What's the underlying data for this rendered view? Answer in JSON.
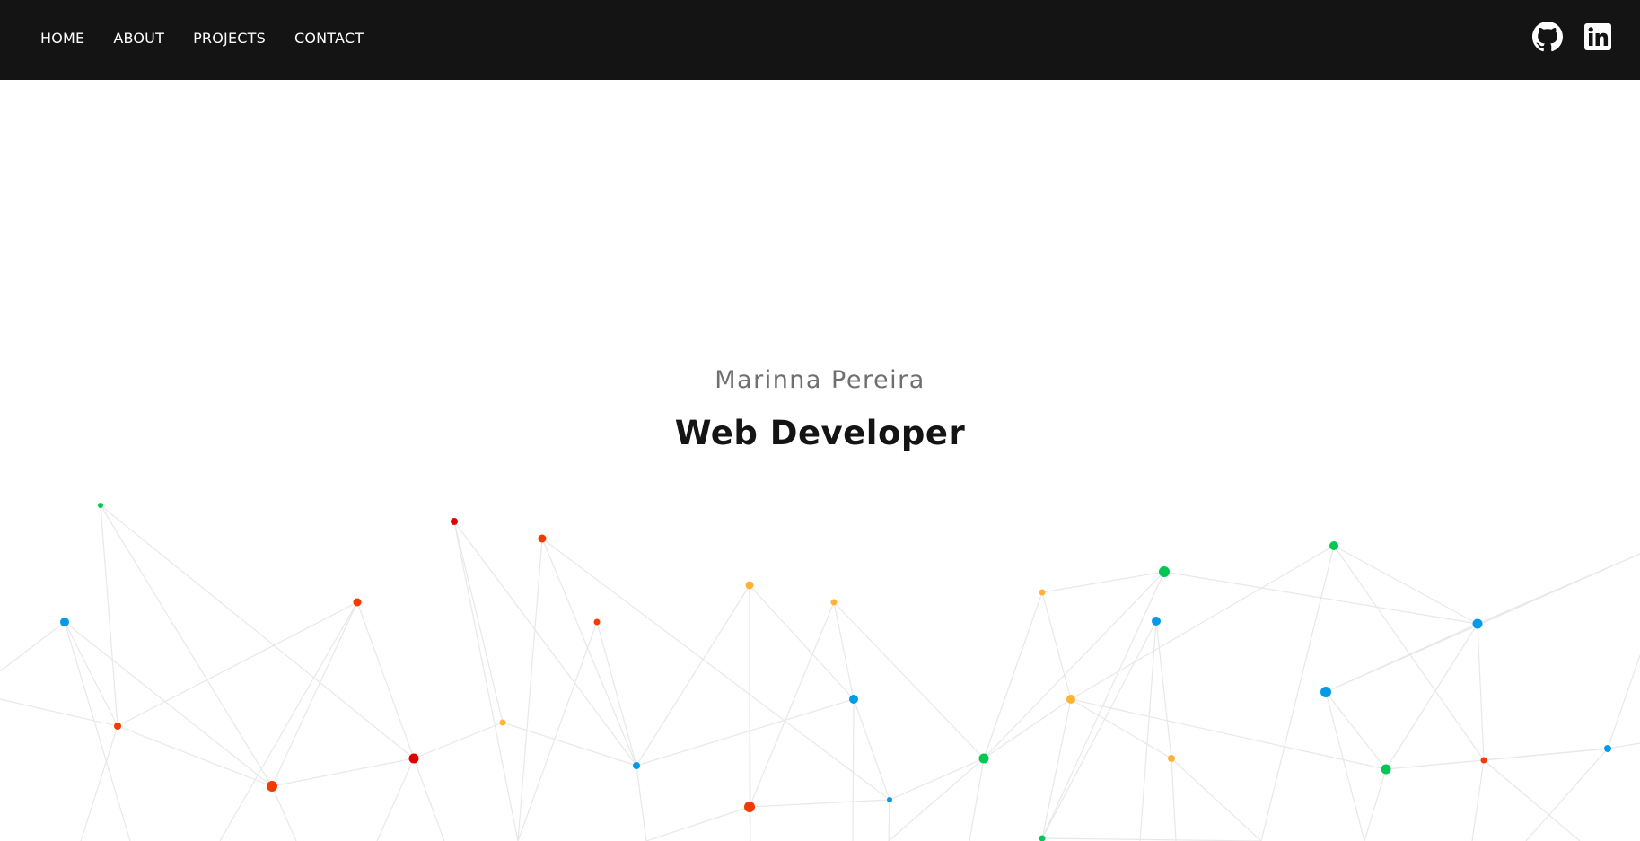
{
  "nav": {
    "links": [
      "HOME",
      "ABOUT",
      "PROJECTS",
      "CONTACT"
    ]
  },
  "social": {
    "github": {
      "icon": "github-icon"
    },
    "linkedin": {
      "icon": "linkedin-icon"
    }
  },
  "hero": {
    "name": "Marinna Pereira",
    "title": "Web Developer"
  },
  "theme": {
    "navbar_bg": "#141414",
    "name_color": "#6f6f6f",
    "title_color": "#141414",
    "line_color": "#e8e8e8",
    "dot_colors": {
      "green": "#00c853",
      "blue": "#039be5",
      "red": "#e00000",
      "orange_red": "#f33a00",
      "orange": "#ffb233"
    }
  }
}
